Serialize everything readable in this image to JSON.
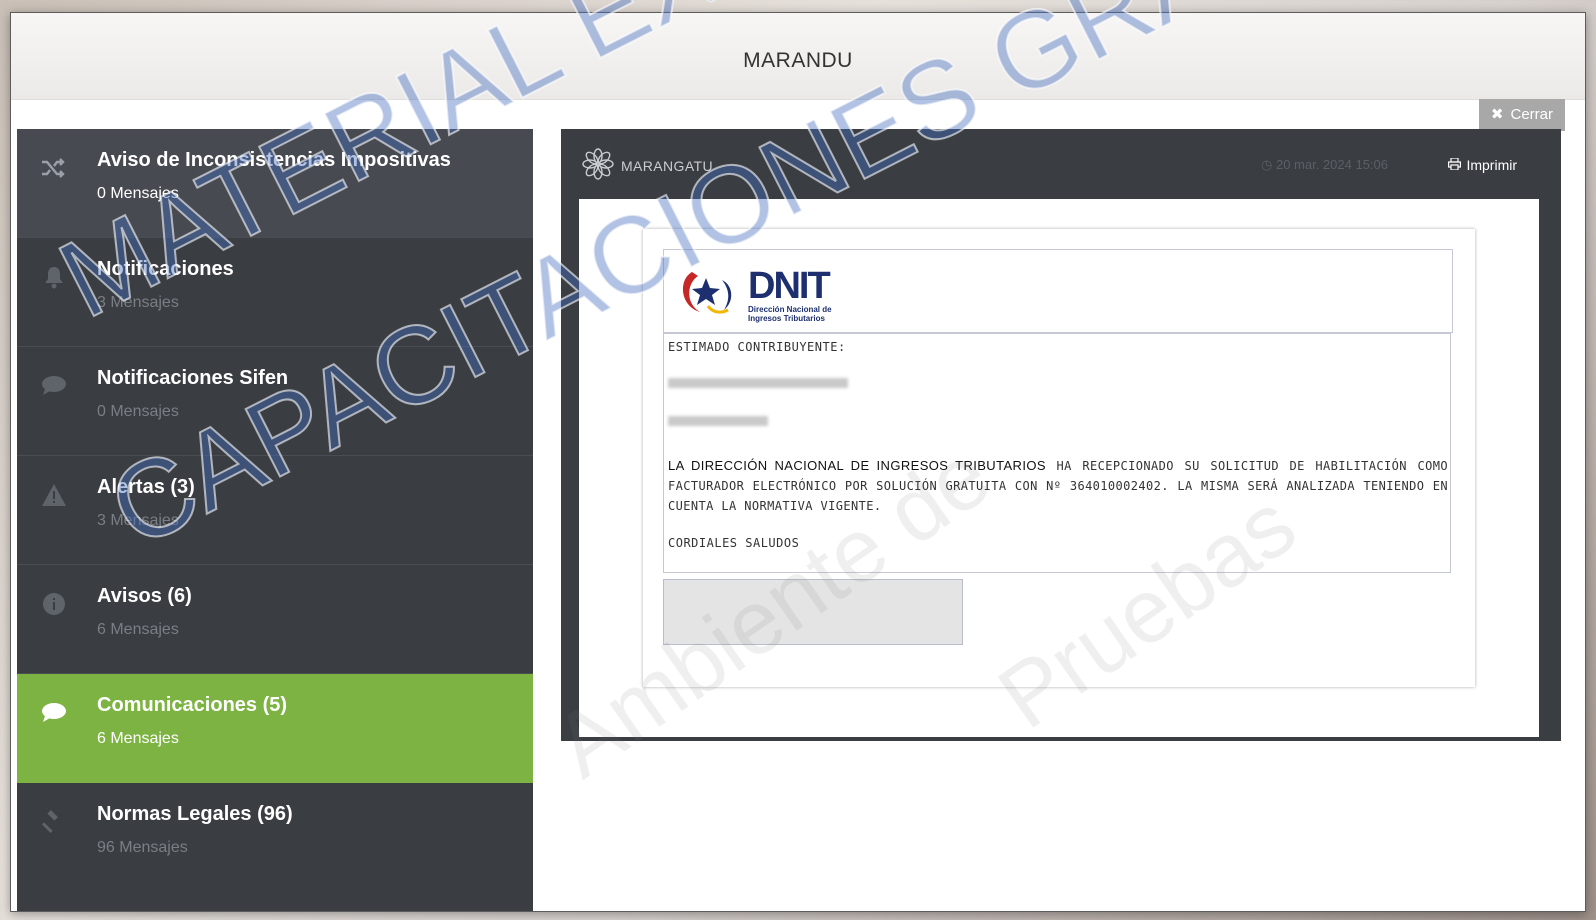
{
  "window": {
    "title": "MARANDU"
  },
  "close_button": {
    "label": "Cerrar"
  },
  "sidebar": {
    "items": [
      {
        "label": "Aviso de Inconsistencias Impositivas",
        "count": "0 Mensajes",
        "icon": "shuffle-icon"
      },
      {
        "label": "Notificaciones",
        "count": "3 Mensajes",
        "icon": "bell-icon"
      },
      {
        "label": "Notificaciones Sifen",
        "count": "0 Mensajes",
        "icon": "comment-icon"
      },
      {
        "label": "Alertas (3)",
        "count": "3 Mensajes",
        "icon": "warning-icon"
      },
      {
        "label": "Avisos (6)",
        "count": "6 Mensajes",
        "icon": "info-icon"
      },
      {
        "label": "Comunicaciones (5)",
        "count": "6 Mensajes",
        "icon": "chat-icon",
        "active": true
      },
      {
        "label": "Normas Legales (96)",
        "count": "96 Mensajes",
        "icon": "gavel-icon"
      }
    ]
  },
  "viewer": {
    "brand": "MARANGATU",
    "date": "20 mar. 2024 15:06",
    "print_label": "Imprimir"
  },
  "document": {
    "logo_word": "DNIT",
    "logo_sub1": "Dirección Nacional de",
    "logo_sub2": "Ingresos Tributarios",
    "greeting": "ESTIMADO CONTRIBUYENTE:",
    "body_org": "LA DIRECCIÓN NACIONAL DE INGRESOS TRIBUTARIOS",
    "body_rest": " HA RECEPCIONADO SU SOLICITUD DE HABILITACIÓN COMO FACTURADOR ELECTRÓNICO POR SOLUCIÓN GRATUITA CON Nº 364010002402. LA MISMA SERÁ ANALIZADA TENIENDO EN CUENTA LA NORMATIVA VIGENTE.",
    "closing": "CORDIALES SALUDOS"
  },
  "watermarks": {
    "line1": "MATERIAL EXCLUSIVO PARA",
    "line2": "CAPACITACIONES GRATUITAS DE LA DNIT",
    "env1": "Ambiente de",
    "env2": "Pruebas"
  },
  "colors": {
    "active": "#7cb342",
    "sidebar": "#3a3d42",
    "logo": "#1d2f6f"
  }
}
